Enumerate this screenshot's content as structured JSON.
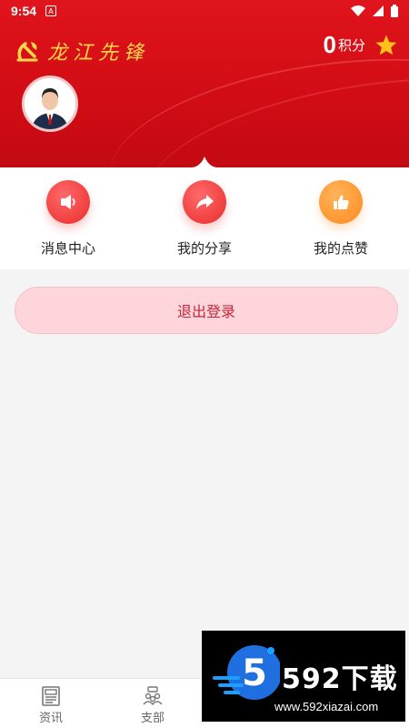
{
  "status_bar": {
    "time": "9:54",
    "notif_glyph": "A",
    "icons": [
      "wifi-icon",
      "signal-icon",
      "battery-icon"
    ]
  },
  "header": {
    "brand": "龙江先锋",
    "points_value": "0",
    "points_label": "积分",
    "colors": {
      "primary": "#d10c14",
      "gold": "#ffd84a"
    }
  },
  "actions": [
    {
      "label": "消息中心",
      "icon": "speaker-icon",
      "color": "red"
    },
    {
      "label": "我的分享",
      "icon": "share-icon",
      "color": "red"
    },
    {
      "label": "我的点赞",
      "icon": "thumbs-up-icon",
      "color": "orange"
    }
  ],
  "logout_label": "退出登录",
  "bottom_nav": [
    {
      "label": "资讯",
      "icon": "news-icon"
    },
    {
      "label": "支部",
      "icon": "branch-icon"
    }
  ],
  "watermark": {
    "title": "592下载",
    "url": "www.592xiazai.com",
    "logo_digit": "5"
  }
}
